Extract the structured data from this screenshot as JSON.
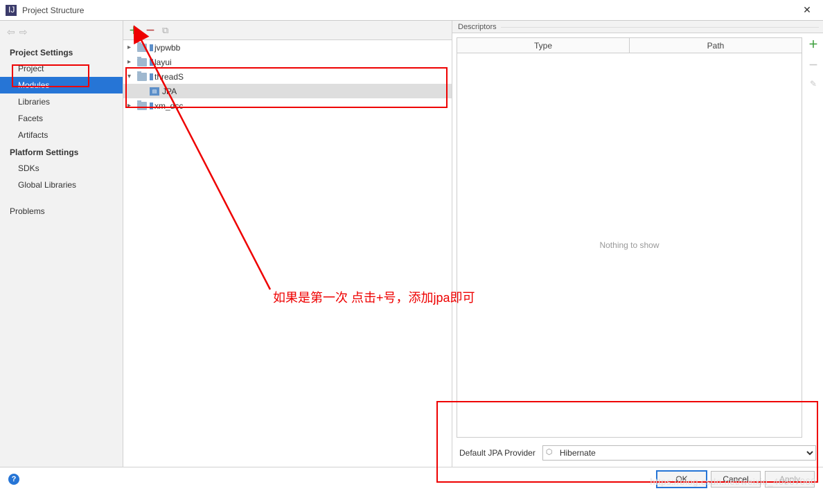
{
  "title": "Project Structure",
  "sidebar": {
    "sections": [
      {
        "title": "Project Settings",
        "items": [
          "Project",
          "Modules",
          "Libraries",
          "Facets",
          "Artifacts"
        ],
        "selectedIndex": 1
      },
      {
        "title": "Platform Settings",
        "items": [
          "SDKs",
          "Global Libraries"
        ]
      }
    ],
    "extra": "Problems"
  },
  "tree": [
    {
      "label": "jvpwbb",
      "level": 1,
      "expanded": false
    },
    {
      "label": "layui",
      "level": 1,
      "expanded": false
    },
    {
      "label": "threadS",
      "level": 1,
      "expanded": true
    },
    {
      "label": "JPA",
      "level": 2,
      "selected": true,
      "icon": "jpa"
    },
    {
      "label": "xm_dcc",
      "level": 1,
      "expanded": false
    }
  ],
  "descriptors": {
    "label": "Descriptors",
    "columns": [
      "Type",
      "Path"
    ],
    "empty": "Nothing to show"
  },
  "provider": {
    "label": "Default JPA Provider",
    "value": "Hibernate"
  },
  "buttons": {
    "ok": "OK",
    "cancel": "Cancel",
    "apply": "Apply"
  },
  "annotation": {
    "text": "如果是第一次 点击+号，添加jpa即可"
  },
  "watermark": "https://blog.csdn.net/weixin_40807060"
}
